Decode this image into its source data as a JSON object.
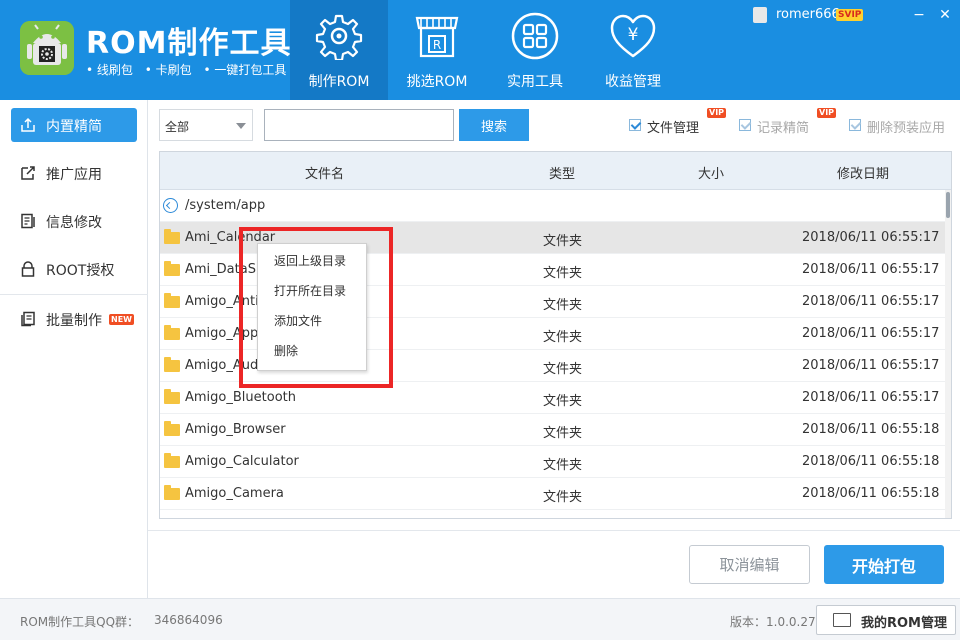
{
  "app": {
    "name": "ROM制作工具",
    "sub_items": [
      "• 线刷包",
      "• 卡刷包",
      "• 一键打包工具"
    ]
  },
  "nav_tabs": [
    {
      "label": "制作ROM",
      "icon": "gear-icon",
      "active": true
    },
    {
      "label": "挑选ROM",
      "icon": "store-icon",
      "active": false
    },
    {
      "label": "实用工具",
      "icon": "grid-icon",
      "active": false
    },
    {
      "label": "收益管理",
      "icon": "yen-heart-icon",
      "active": false
    }
  ],
  "user": {
    "name": "romer666",
    "badge": "SVIP"
  },
  "window_controls": {
    "minimize": "−",
    "close": "✕"
  },
  "sidebar": {
    "items": [
      {
        "label": "内置精简",
        "icon": "upload-icon",
        "active": true
      },
      {
        "label": "推广应用",
        "icon": "share-icon",
        "active": false
      },
      {
        "label": "信息修改",
        "icon": "document-edit-icon",
        "active": false
      },
      {
        "label": "ROOT授权",
        "icon": "lock-icon",
        "active": false
      },
      {
        "label": "批量制作",
        "icon": "batch-icon",
        "active": false,
        "badge": "NEW"
      }
    ]
  },
  "toolbar": {
    "filter_value": "全部",
    "search_value": "",
    "search_button": "搜索",
    "checkboxes": [
      {
        "label": "文件管理",
        "checked": true,
        "vip": "VIP",
        "enabled": true
      },
      {
        "label": "记录精简",
        "checked": true,
        "vip": "VIP",
        "enabled": false
      },
      {
        "label": "删除预装应用",
        "checked": true,
        "enabled": false
      }
    ]
  },
  "table": {
    "columns": [
      "文件名",
      "类型",
      "大小",
      "修改日期"
    ],
    "path": "/system/app",
    "rows": [
      {
        "name": "Ami_Calendar",
        "type": "文件夹",
        "size": "",
        "date": "2018/06/11 06:55:17"
      },
      {
        "name": "Ami_DataSho",
        "type": "文件夹",
        "size": "",
        "date": "2018/06/11 06:55:17"
      },
      {
        "name": "Amigo_AntiS",
        "type": "文件夹",
        "size": "",
        "date": "2018/06/11 06:55:17"
      },
      {
        "name": "Amigo_AppSt",
        "type": "文件夹",
        "size": "",
        "date": "2018/06/11 06:55:17"
      },
      {
        "name": "Amigo_Audio",
        "type": "文件夹",
        "size": "",
        "date": "2018/06/11 06:55:17"
      },
      {
        "name": "Amigo_Bluetooth",
        "type": "文件夹",
        "size": "",
        "date": "2018/06/11 06:55:17"
      },
      {
        "name": "Amigo_Browser",
        "type": "文件夹",
        "size": "",
        "date": "2018/06/11 06:55:18"
      },
      {
        "name": "Amigo_Calculator",
        "type": "文件夹",
        "size": "",
        "date": "2018/06/11 06:55:18"
      },
      {
        "name": "Amigo_Camera",
        "type": "文件夹",
        "size": "",
        "date": "2018/06/11 06:55:18"
      }
    ]
  },
  "context_menu": {
    "items": [
      "返回上级目录",
      "打开所在目录",
      "添加文件",
      "删除"
    ]
  },
  "actions": {
    "cancel": "取消编辑",
    "start": "开始打包"
  },
  "footer": {
    "qq_label": "ROM制作工具QQ群：",
    "qq_number": "346864096",
    "version": "版本：1.0.0.27",
    "my_rom": "我的ROM管理"
  },
  "colors": {
    "header_blue": "#1a8ee1",
    "accent": "#2d9ae8",
    "highlight": "#ec2626"
  }
}
